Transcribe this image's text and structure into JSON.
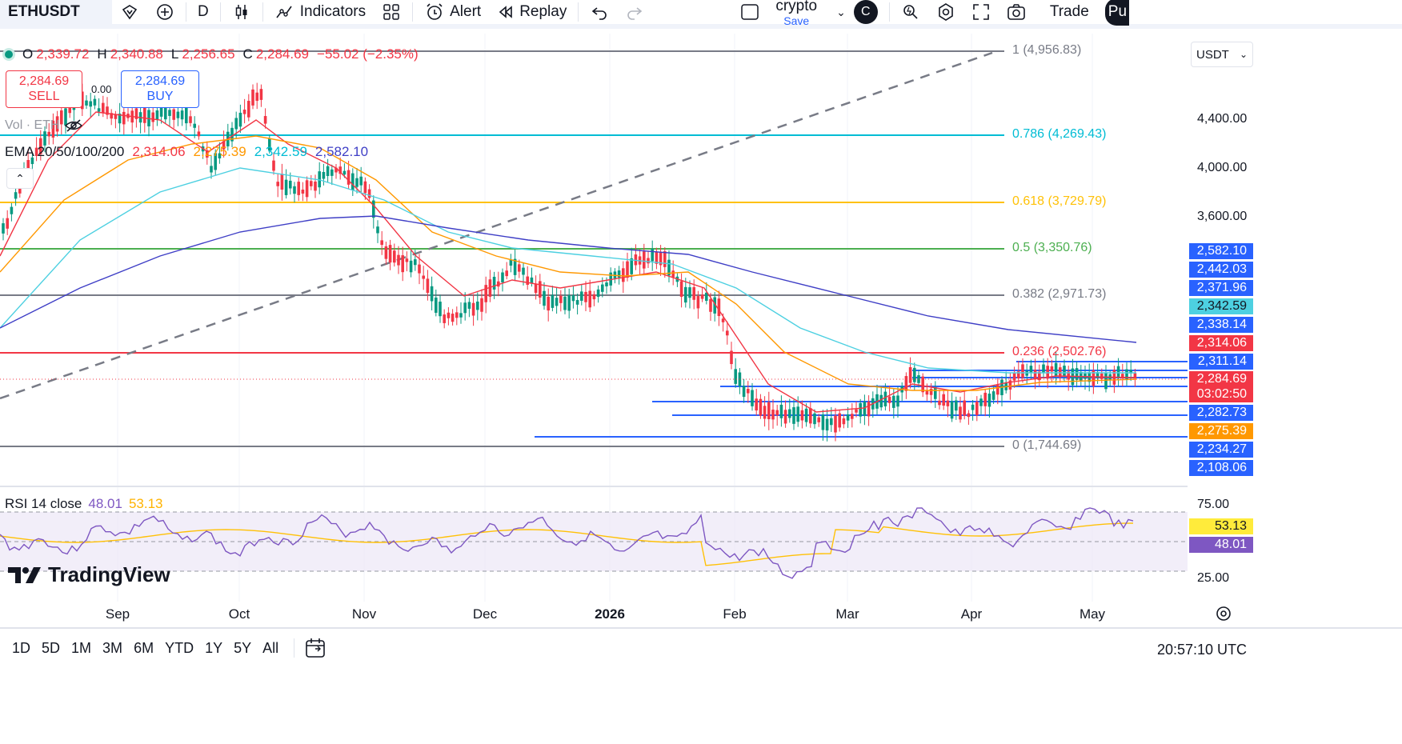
{
  "toolbar": {
    "symbol": "ETHUSDT",
    "interval": "D",
    "indicators_label": "Indicators",
    "alert_label": "Alert",
    "replay_label": "Replay",
    "layout_name": "crypto",
    "layout_status": "Save",
    "avatar_letter": "C",
    "trade_label": "Trade",
    "publish_partial": "Pu"
  },
  "legend": {
    "o_key": "O",
    "o_val": "2,339.72",
    "h_key": "H",
    "h_val": "2,340.88",
    "l_key": "L",
    "l_val": "2,256.65",
    "c_key": "C",
    "c_val": "2,284.69",
    "change": "−55.02 (−2.35%)"
  },
  "trade": {
    "sell_price": "2,284.69",
    "sell_label": "SELL",
    "buy_price": "2,284.69",
    "buy_label": "BUY",
    "spread": "0.00"
  },
  "volume": {
    "label": "Vol · ETH"
  },
  "ema": {
    "label": "EMA 20/50/100/200",
    "v20": "2,314.06",
    "v50": "2,275.39",
    "v100": "2,342.59",
    "v200": "2,582.10",
    "colors": {
      "ema20": "#f23645",
      "ema50": "#ff9800",
      "ema100": "#4dd0e1",
      "ema200": "#3f3fc6"
    }
  },
  "fib": [
    {
      "label": "1 (4,956.83)",
      "price": 4956.83,
      "color": "#787b86"
    },
    {
      "label": "0.786 (4,269.43)",
      "price": 4269.43,
      "color": "#00bcd4"
    },
    {
      "label": "0.618 (3,729.79)",
      "price": 3729.79,
      "color": "#ffc107"
    },
    {
      "label": "0.5 (3,350.76)",
      "price": 3350.76,
      "color": "#4caf50"
    },
    {
      "label": "0.382 (2,971.73)",
      "price": 2971.73,
      "color": "#787b86"
    },
    {
      "label": "0.236 (2,502.76)",
      "price": 2502.76,
      "color": "#f23645"
    },
    {
      "label": "0 (1,744.69)",
      "price": 1744.69,
      "color": "#787b86"
    }
  ],
  "price_scale": {
    "currency": "USDT",
    "ticks": [
      "4,400.00",
      "4,000.00",
      "3,600.00"
    ],
    "badges": [
      {
        "text": "2,582.10",
        "color": "#2962ff"
      },
      {
        "text": "2,442.03",
        "color": "#2962ff"
      },
      {
        "text": "2,371.96",
        "color": "#2962ff"
      },
      {
        "text": "2,342.59",
        "color": "#4dd0e1"
      },
      {
        "text": "2,338.14",
        "color": "#2962ff"
      },
      {
        "text": "2,314.06",
        "color": "#f23645"
      },
      {
        "text": "2,311.14",
        "color": "#2962ff"
      },
      {
        "text": "2,284.69",
        "color": "#f23645"
      },
      {
        "text": "03:02:50",
        "color": "#f23645"
      },
      {
        "text": "2,282.73",
        "color": "#2962ff"
      },
      {
        "text": "2,275.39",
        "color": "#ff9800"
      },
      {
        "text": "2,234.27",
        "color": "#2962ff"
      },
      {
        "text": "2,108.06",
        "color": "#2962ff"
      }
    ],
    "rsi_ticks": [
      "75.00",
      "25.00"
    ],
    "rsi_badges": [
      {
        "text": "53.13",
        "color": "#ffeb3b"
      },
      {
        "text": "48.01",
        "color": "#7e57c2"
      }
    ]
  },
  "rsi": {
    "label": "RSI 14 close",
    "value": "48.01",
    "ma": "53.13",
    "color": "#7e57c2",
    "ma_color": "#ffc107"
  },
  "time_axis": [
    "Sep",
    "Oct",
    "Nov",
    "Dec",
    "2026",
    "Feb",
    "Mar",
    "Apr",
    "May"
  ],
  "bottom": {
    "ranges": [
      "1D",
      "5D",
      "1M",
      "3M",
      "6M",
      "YTD",
      "1Y",
      "5Y",
      "All"
    ],
    "clock": "20:57:10 UTC"
  },
  "brand": "TradingView"
}
